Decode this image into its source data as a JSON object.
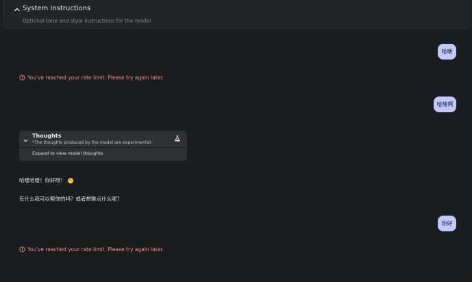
{
  "system_instructions": {
    "title": "System Instructions",
    "subtitle": "Optional tone and style instructions for the model",
    "expanded_icon": "chevron-up-icon"
  },
  "messages": [
    {
      "role": "user",
      "text": "哈喽"
    },
    {
      "role": "error",
      "text": "You've reached your rate limit. Please try again later.",
      "icon": "error-circle-icon"
    },
    {
      "role": "user",
      "text": "哈喽啊"
    },
    {
      "role": "model",
      "thoughts": {
        "title": "Thoughts",
        "subtitle": "*The thoughts produced by the model are experimental",
        "expand_label": "Expand to view model thoughts",
        "icon": "flask-icon",
        "toggle_icon": "chevron-down-icon"
      },
      "lines": [
        "哈喽哈喽！你好呀！",
        "有什么我可以帮你的吗？或者想聊点什么呢？"
      ],
      "emoji": "smiling-face-emoji"
    },
    {
      "role": "user",
      "text": "你好"
    },
    {
      "role": "error",
      "text": "You've reached your rate limit. Please try again later.",
      "icon": "error-circle-icon"
    }
  ],
  "colors": {
    "background": "#1b1c1e",
    "panel": "#232427",
    "user_bubble": "#c2c8ff",
    "error": "#f28b82",
    "thoughts_panel": "#303134"
  }
}
